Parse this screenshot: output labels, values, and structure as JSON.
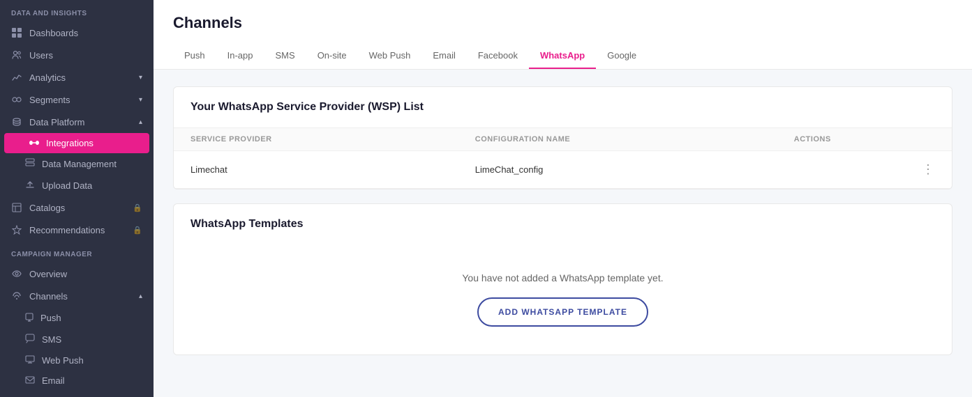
{
  "sidebar": {
    "section1_title": "DATA AND INSIGHTS",
    "items1": [
      {
        "id": "dashboards",
        "label": "Dashboards",
        "icon": "grid-icon",
        "hasChevron": false
      },
      {
        "id": "users",
        "label": "Users",
        "icon": "users-icon",
        "hasChevron": false
      },
      {
        "id": "analytics",
        "label": "Analytics",
        "icon": "analytics-icon",
        "hasChevron": true
      },
      {
        "id": "segments",
        "label": "Segments",
        "icon": "segments-icon",
        "hasChevron": true
      },
      {
        "id": "data-platform",
        "label": "Data Platform",
        "icon": "data-platform-icon",
        "hasChevron": true,
        "expanded": true
      }
    ],
    "items1_sub": [
      {
        "id": "integrations",
        "label": "Integrations",
        "icon": "integrations-icon",
        "active": true
      },
      {
        "id": "data-management",
        "label": "Data Management",
        "icon": "data-mgmt-icon"
      },
      {
        "id": "upload-data",
        "label": "Upload Data",
        "icon": "upload-icon"
      }
    ],
    "items1_more": [
      {
        "id": "catalogs",
        "label": "Catalogs",
        "icon": "catalogs-icon",
        "hasLock": true
      },
      {
        "id": "recommendations",
        "label": "Recommendations",
        "icon": "recommendations-icon",
        "hasLock": true
      }
    ],
    "section2_title": "CAMPAIGN MANAGER",
    "items2": [
      {
        "id": "overview",
        "label": "Overview",
        "icon": "eye-icon"
      },
      {
        "id": "channels",
        "label": "Channels",
        "icon": "channels-icon",
        "hasChevron": true,
        "expanded": true
      }
    ],
    "items2_sub": [
      {
        "id": "push",
        "label": "Push",
        "icon": "push-icon"
      },
      {
        "id": "sms",
        "label": "SMS",
        "icon": "sms-icon"
      },
      {
        "id": "web-push",
        "label": "Web Push",
        "icon": "web-push-icon"
      },
      {
        "id": "email",
        "label": "Email",
        "icon": "email-icon"
      }
    ]
  },
  "page": {
    "title": "Channels",
    "tabs": [
      {
        "id": "push",
        "label": "Push"
      },
      {
        "id": "in-app",
        "label": "In-app"
      },
      {
        "id": "sms",
        "label": "SMS"
      },
      {
        "id": "on-site",
        "label": "On-site"
      },
      {
        "id": "web-push",
        "label": "Web Push"
      },
      {
        "id": "email",
        "label": "Email"
      },
      {
        "id": "facebook",
        "label": "Facebook"
      },
      {
        "id": "whatsapp",
        "label": "WhatsApp",
        "active": true
      },
      {
        "id": "google",
        "label": "Google"
      }
    ]
  },
  "wsp_card": {
    "title": "Your WhatsApp Service Provider (WSP) List",
    "col1": "SERVICE PROVIDER",
    "col2": "CONFIGURATION NAME",
    "col3": "ACTIONS",
    "rows": [
      {
        "provider": "Limechat",
        "config": "LimeChat_config"
      }
    ]
  },
  "templates_card": {
    "title": "WhatsApp Templates",
    "empty_text": "You have not added a WhatsApp template yet.",
    "add_button": "ADD WHATSAPP TEMPLATE"
  }
}
